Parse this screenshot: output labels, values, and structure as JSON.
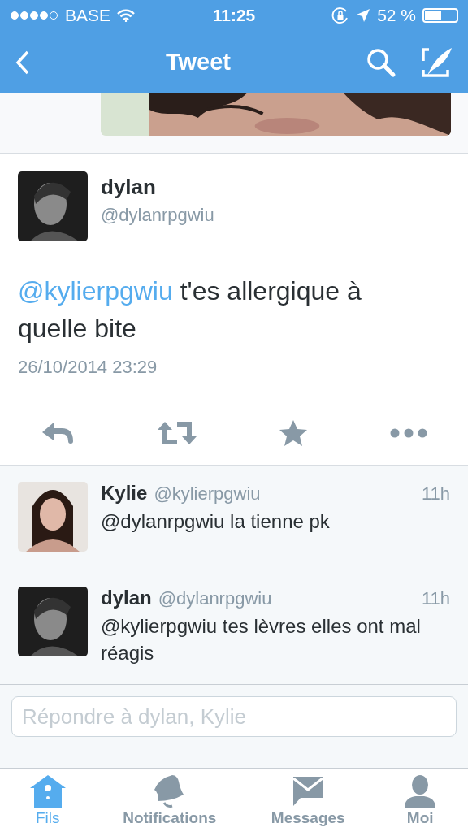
{
  "status_bar": {
    "carrier": "BASE",
    "time": "11:25",
    "battery": "52 %"
  },
  "nav": {
    "title": "Tweet"
  },
  "tweet": {
    "name": "dylan",
    "handle": "@dylanrpgwiu",
    "mention": "@kylierpgwiu",
    "text": " t'es allergique à quelle bite",
    "date": "26/10/2014 23:29"
  },
  "replies": [
    {
      "name": "Kylie",
      "handle": "@kylierpgwiu",
      "time": "11h",
      "text": "@dylanrpgwiu la tienne pk",
      "kind": "girl"
    },
    {
      "name": "dylan",
      "handle": "@dylanrpgwiu",
      "time": "11h",
      "text": "@kylierpgwiu tes lèvres elles ont mal réagis",
      "kind": "boy"
    }
  ],
  "reply_field": {
    "placeholder": "Répondre à dylan, Kylie"
  },
  "tab_bar": [
    {
      "label": "Fils",
      "selected": true
    },
    {
      "label": "Notifications",
      "selected": false
    },
    {
      "label": "Messages",
      "selected": false
    },
    {
      "label": "Moi",
      "selected": false
    }
  ]
}
